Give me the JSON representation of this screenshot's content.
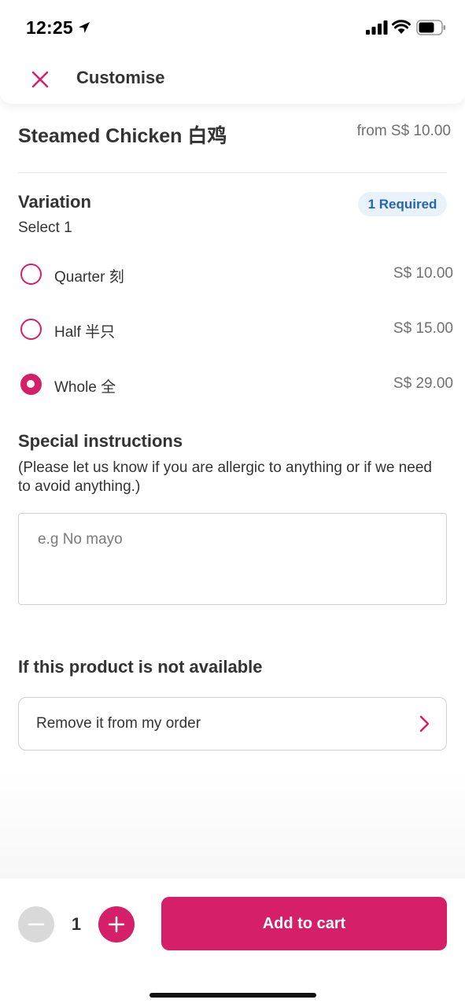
{
  "status_bar": {
    "time": "12:25"
  },
  "header": {
    "title": "Customise"
  },
  "product": {
    "name": "Steamed Chicken 白鸡",
    "price": "from S$ 10.00"
  },
  "variation": {
    "title": "Variation",
    "subtitle": "Select 1",
    "badge": "1 Required",
    "options": [
      {
        "label": "Quarter 刻",
        "price": "S$ 10.00",
        "selected": false
      },
      {
        "label": "Half 半只",
        "price": "S$ 15.00",
        "selected": false
      },
      {
        "label": "Whole 全",
        "price": "S$ 29.00",
        "selected": true
      }
    ]
  },
  "instructions": {
    "title": "Special instructions",
    "description": "(Please let us know if you are allergic to anything or if we need to avoid anything.)",
    "placeholder": "e.g No mayo",
    "value": ""
  },
  "availability": {
    "title": "If this product is not available",
    "selected": "Remove it from my order"
  },
  "cart": {
    "quantity": "1",
    "button_label": "Add to cart"
  },
  "colors": {
    "accent": "#d61f69",
    "badge_text": "#2566b1",
    "badge_bg": "#e9f1f9",
    "disabled": "#d9d9d9"
  },
  "icons": {
    "close": "close-icon",
    "chevron": "chevron-right-icon",
    "minus": "minus-icon",
    "plus": "plus-icon",
    "location": "location-arrow-icon",
    "signal": "cellular-signal-icon",
    "wifi": "wifi-icon",
    "battery": "battery-icon"
  }
}
